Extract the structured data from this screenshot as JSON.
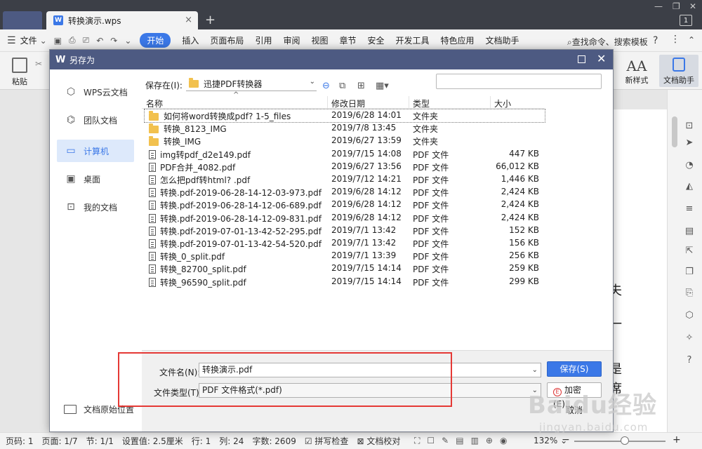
{
  "window": {
    "tab_title": "转换演示.wps",
    "page_badge": "1"
  },
  "menubar": {
    "file_label": "文件",
    "tabs": [
      "开始",
      "插入",
      "页面布局",
      "引用",
      "审阅",
      "视图",
      "章节",
      "安全",
      "开发工具",
      "特色应用",
      "文档助手"
    ],
    "search_label": "查找命令、搜索模板"
  },
  "ribbon": {
    "paste_label": "粘贴",
    "newstyle_label": "新样式",
    "helper_label": "文档助手"
  },
  "document": {
    "text_lines": [
      "夫",
      "一",
      "是",
      "席"
    ]
  },
  "dialog": {
    "title": "另存为",
    "places": [
      {
        "label": "WPS云文档",
        "icon": "cube-icon"
      },
      {
        "label": "团队文档",
        "icon": "team-icon"
      },
      {
        "label": "计算机",
        "icon": "computer-icon"
      },
      {
        "label": "桌面",
        "icon": "desktop-icon"
      },
      {
        "label": "我的文档",
        "icon": "my-documents-icon"
      }
    ],
    "selected_place": "计算机",
    "save_in_label": "保存在(I):",
    "save_in_value": "迅捷PDF转换器",
    "columns": {
      "name": "名称",
      "date": "修改日期",
      "type": "类型",
      "size": "大小"
    },
    "files": [
      {
        "name": "如何将word转换成pdf? 1-5_files",
        "date": "2019/6/28 14:01",
        "type": "文件夹",
        "size": "",
        "kind": "folder"
      },
      {
        "name": "转换_8123_IMG",
        "date": "2019/7/8 13:45",
        "type": "文件夹",
        "size": "",
        "kind": "folder"
      },
      {
        "name": "转换_IMG",
        "date": "2019/6/27 13:59",
        "type": "文件夹",
        "size": "",
        "kind": "folder"
      },
      {
        "name": "img转pdf_d2e149.pdf",
        "date": "2019/7/15 14:08",
        "type": "PDF 文件",
        "size": "447 KB",
        "kind": "pdf"
      },
      {
        "name": "PDF合并_4082.pdf",
        "date": "2019/6/27 13:56",
        "type": "PDF 文件",
        "size": "66,012 KB",
        "kind": "pdf"
      },
      {
        "name": "怎么把pdf转html? .pdf",
        "date": "2019/7/12 14:21",
        "type": "PDF 文件",
        "size": "1,446 KB",
        "kind": "pdf"
      },
      {
        "name": "转换.pdf-2019-06-28-14-12-03-973.pdf",
        "date": "2019/6/28 14:12",
        "type": "PDF 文件",
        "size": "2,424 KB",
        "kind": "pdf"
      },
      {
        "name": "转换.pdf-2019-06-28-14-12-06-689.pdf",
        "date": "2019/6/28 14:12",
        "type": "PDF 文件",
        "size": "2,424 KB",
        "kind": "pdf"
      },
      {
        "name": "转换.pdf-2019-06-28-14-12-09-831.pdf",
        "date": "2019/6/28 14:12",
        "type": "PDF 文件",
        "size": "2,424 KB",
        "kind": "pdf"
      },
      {
        "name": "转换.pdf-2019-07-01-13-42-52-295.pdf",
        "date": "2019/7/1 13:42",
        "type": "PDF 文件",
        "size": "152 KB",
        "kind": "pdf"
      },
      {
        "name": "转换.pdf-2019-07-01-13-42-54-520.pdf",
        "date": "2019/7/1 13:42",
        "type": "PDF 文件",
        "size": "156 KB",
        "kind": "pdf"
      },
      {
        "name": "转换_0_split.pdf",
        "date": "2019/7/1 13:39",
        "type": "PDF 文件",
        "size": "256 KB",
        "kind": "pdf"
      },
      {
        "name": "转换_82700_split.pdf",
        "date": "2019/7/15 14:14",
        "type": "PDF 文件",
        "size": "259 KB",
        "kind": "pdf"
      },
      {
        "name": "转换_96590_split.pdf",
        "date": "2019/7/15 14:14",
        "type": "PDF 文件",
        "size": "299 KB",
        "kind": "pdf"
      }
    ],
    "filename_label": "文件名(N):",
    "filename_value": "转换演示.pdf",
    "filetype_label": "文件类型(T):",
    "filetype_value": "PDF 文件格式(*.pdf)",
    "save_label": "保存(S)",
    "encrypt_label": "加密(E)...",
    "cancel_label": "取消",
    "original_location_label": "文档原始位置"
  },
  "statusbar": {
    "items": [
      "页码: 1",
      "页面: 1/7",
      "节: 1/1",
      "设置值: 2.5厘米",
      "行: 1",
      "列: 24",
      "字数: 2609",
      "拼写检查",
      "文档校对"
    ],
    "zoom": "132%"
  },
  "watermark": {
    "line1": "Baidu经验",
    "line2": "jingyan.baidu.com"
  },
  "colors": {
    "accent": "#3b78e7",
    "dialog_title": "#4d5a82",
    "highlight": "#e53935"
  }
}
